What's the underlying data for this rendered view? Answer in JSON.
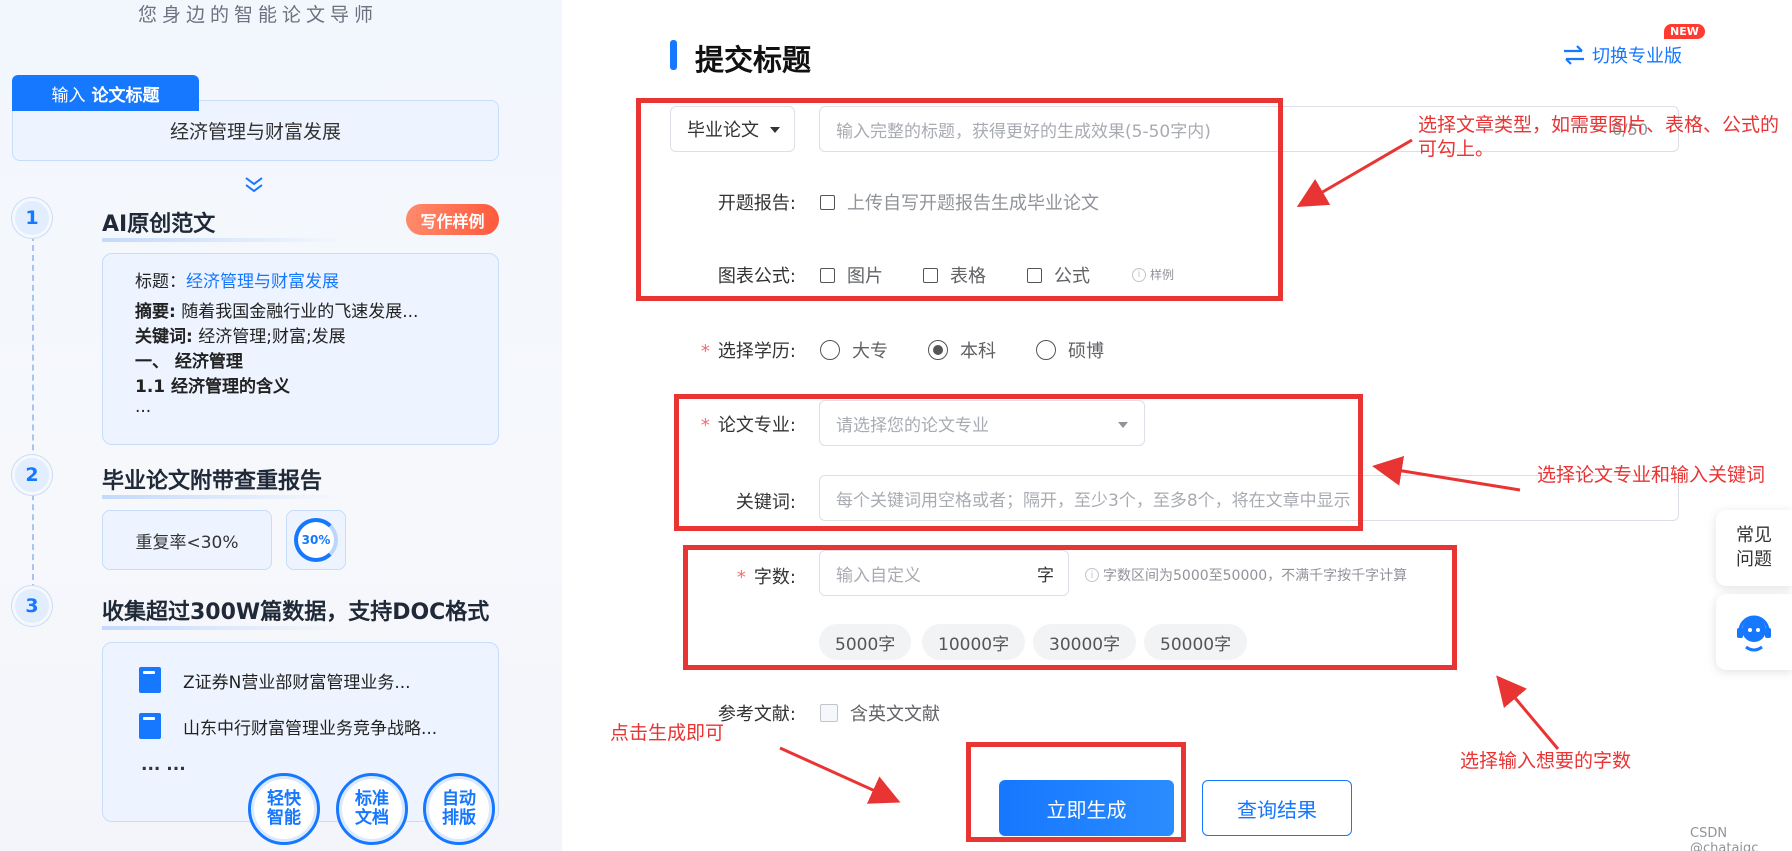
{
  "left": {
    "tagline": "您身边的智能论文导师",
    "input_tab_prefix": "输入",
    "input_tab_bold": "论文标题",
    "title_value": "经济管理与财富发展",
    "steps": [
      {
        "num": "1",
        "title": "AI原创范文",
        "badge": "写作样例"
      },
      {
        "num": "2",
        "title": "毕业论文附带查重报告"
      },
      {
        "num": "3",
        "title": "收集超过300W篇数据，支持DOC格式"
      }
    ],
    "sample": {
      "title_label": "标题：",
      "title_value": "经济管理与财富发展",
      "abstract_label": "摘要:",
      "abstract_value": " 随着我国金融行业的飞速发展...",
      "keywords_label": "关键词:",
      "keywords_value": " 经济管理;财富;发展",
      "heading1": "一、 经济管理",
      "heading2": "1.1 经济管理的含义",
      "ellipsis": "..."
    },
    "report": {
      "rate_text": "重复率<30%",
      "ring_value": "30%"
    },
    "docs": [
      "Z证券N营业部财富管理业务...",
      "山东中行财富管理业务竞争战略...",
      "... ..."
    ],
    "features": [
      "轻快\n智能",
      "标准\n文档",
      "自动\n排版"
    ]
  },
  "form": {
    "section_title": "提交标题",
    "switch_label": "切换专业版",
    "new_badge": "NEW",
    "paper_type": "毕业论文",
    "title_placeholder": "输入完整的标题，获得更好的生成效果(5-50字内)",
    "title_counter": "0/50",
    "proposal_label": "开题报告:",
    "proposal_option": "上传自写开题报告生成毕业论文",
    "figures_label": "图表公式:",
    "figure_options": [
      "图片",
      "表格",
      "公式"
    ],
    "figure_sample": "样例",
    "education_label": "选择学历:",
    "education_options": [
      "大专",
      "本科",
      "硕博"
    ],
    "education_selected": "本科",
    "major_label": "论文专业:",
    "major_placeholder": "请选择您的论文专业",
    "keywords_label": "关键词:",
    "keywords_placeholder": "每个关键词用空格或者；隔开，至少3个，至多8个，将在文章中显示",
    "words_label": "字数:",
    "words_placeholder": "输入自定义",
    "words_unit": "字",
    "words_hint": "字数区间为5000至50000，不满千字按千字计算",
    "word_chips": [
      "5000字",
      "10000字",
      "30000字",
      "50000字"
    ],
    "refs_label": "参考文献:",
    "refs_option": "含英文文献",
    "generate_button": "立即生成",
    "query_button": "查询结果"
  },
  "side": {
    "faq": "常见\n问题",
    "cs_icon": "customer-service-icon"
  },
  "annotations": {
    "a1": "选择文章类型，如需要图片、表格、公式的可勾上。",
    "a2": "选择论文专业和输入关键词",
    "a3": "选择输入想要的字数",
    "a4": "点击生成即可"
  },
  "watermark": "CSDN @chataigc",
  "colors": {
    "accent": "#1677ff",
    "annotation": "#e93434",
    "badge": "#ff5a3d"
  }
}
